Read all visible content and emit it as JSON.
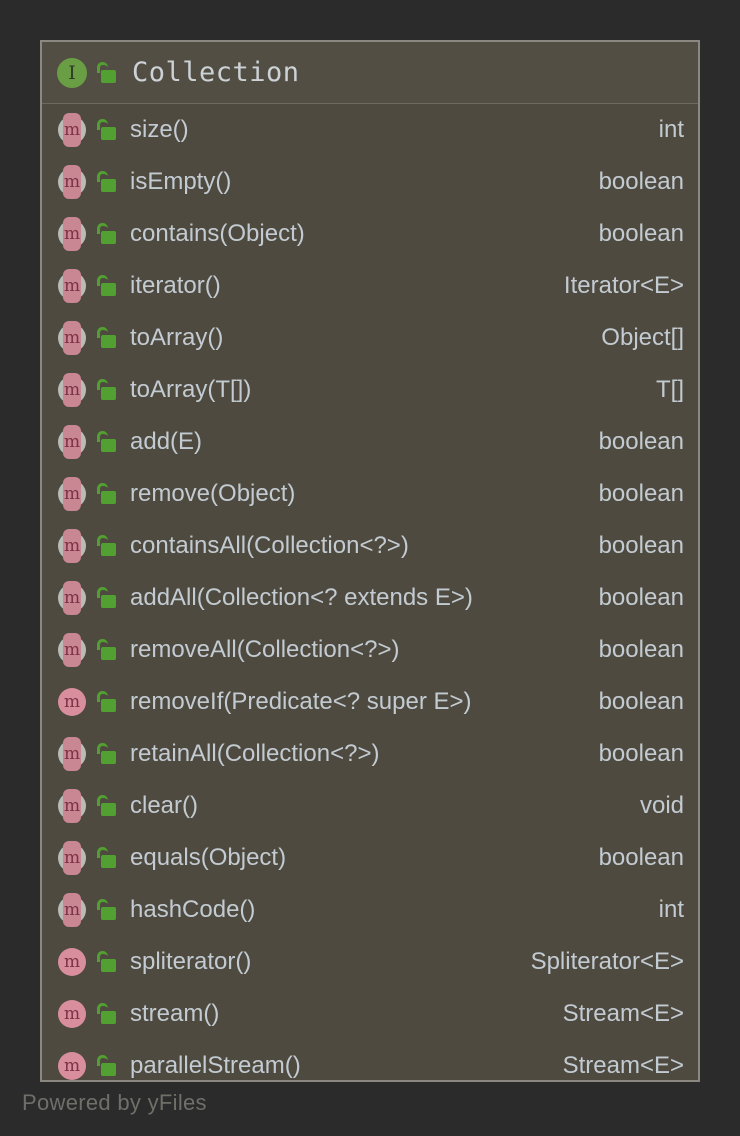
{
  "node": {
    "header": {
      "name": "Collection",
      "stereotype_icon": "interface-icon",
      "stereotype_letter": "I",
      "visibility_icon": "unlocked-padlock-icon",
      "visibility": "public"
    },
    "members": [
      {
        "name": "size()",
        "type": "int",
        "kind": "abstract-method",
        "visibility": "public"
      },
      {
        "name": "isEmpty()",
        "type": "boolean",
        "kind": "abstract-method",
        "visibility": "public"
      },
      {
        "name": "contains(Object)",
        "type": "boolean",
        "kind": "abstract-method",
        "visibility": "public"
      },
      {
        "name": "iterator()",
        "type": "Iterator<E>",
        "kind": "abstract-method",
        "visibility": "public"
      },
      {
        "name": "toArray()",
        "type": "Object[]",
        "kind": "abstract-method",
        "visibility": "public"
      },
      {
        "name": "toArray(T[])",
        "type": "T[]",
        "kind": "abstract-method",
        "visibility": "public"
      },
      {
        "name": "add(E)",
        "type": "boolean",
        "kind": "abstract-method",
        "visibility": "public"
      },
      {
        "name": "remove(Object)",
        "type": "boolean",
        "kind": "abstract-method",
        "visibility": "public"
      },
      {
        "name": "containsAll(Collection<?>)",
        "type": "boolean",
        "kind": "abstract-method",
        "visibility": "public"
      },
      {
        "name": "addAll(Collection<? extends E>)",
        "type": "boolean",
        "kind": "abstract-method",
        "visibility": "public"
      },
      {
        "name": "removeAll(Collection<?>)",
        "type": "boolean",
        "kind": "abstract-method",
        "visibility": "public"
      },
      {
        "name": "removeIf(Predicate<? super E>)",
        "type": "boolean",
        "kind": "default-method",
        "visibility": "public"
      },
      {
        "name": "retainAll(Collection<?>)",
        "type": "boolean",
        "kind": "abstract-method",
        "visibility": "public"
      },
      {
        "name": "clear()",
        "type": "void",
        "kind": "abstract-method",
        "visibility": "public"
      },
      {
        "name": "equals(Object)",
        "type": "boolean",
        "kind": "abstract-method",
        "visibility": "public"
      },
      {
        "name": "hashCode()",
        "type": "int",
        "kind": "abstract-method",
        "visibility": "public"
      },
      {
        "name": "spliterator()",
        "type": "Spliterator<E>",
        "kind": "default-method",
        "visibility": "public"
      },
      {
        "name": "stream()",
        "type": "Stream<E>",
        "kind": "default-method",
        "visibility": "public"
      },
      {
        "name": "parallelStream()",
        "type": "Stream<E>",
        "kind": "default-method",
        "visibility": "public"
      }
    ]
  },
  "watermark": {
    "text": "Powered by yFiles"
  },
  "colors": {
    "canvas_background": "#2b2b2b",
    "node_background": "#4e4a3f",
    "node_header_background": "#524e43",
    "node_border": "#8a8880",
    "text": "#c3cbd2",
    "interface_icon": "#6a9e45",
    "method_icon": "#d98e9e",
    "abstract_method_icon": "#b9bcb6",
    "lock_icon": "#53a032",
    "watermark_text": "#6f6f6a"
  }
}
